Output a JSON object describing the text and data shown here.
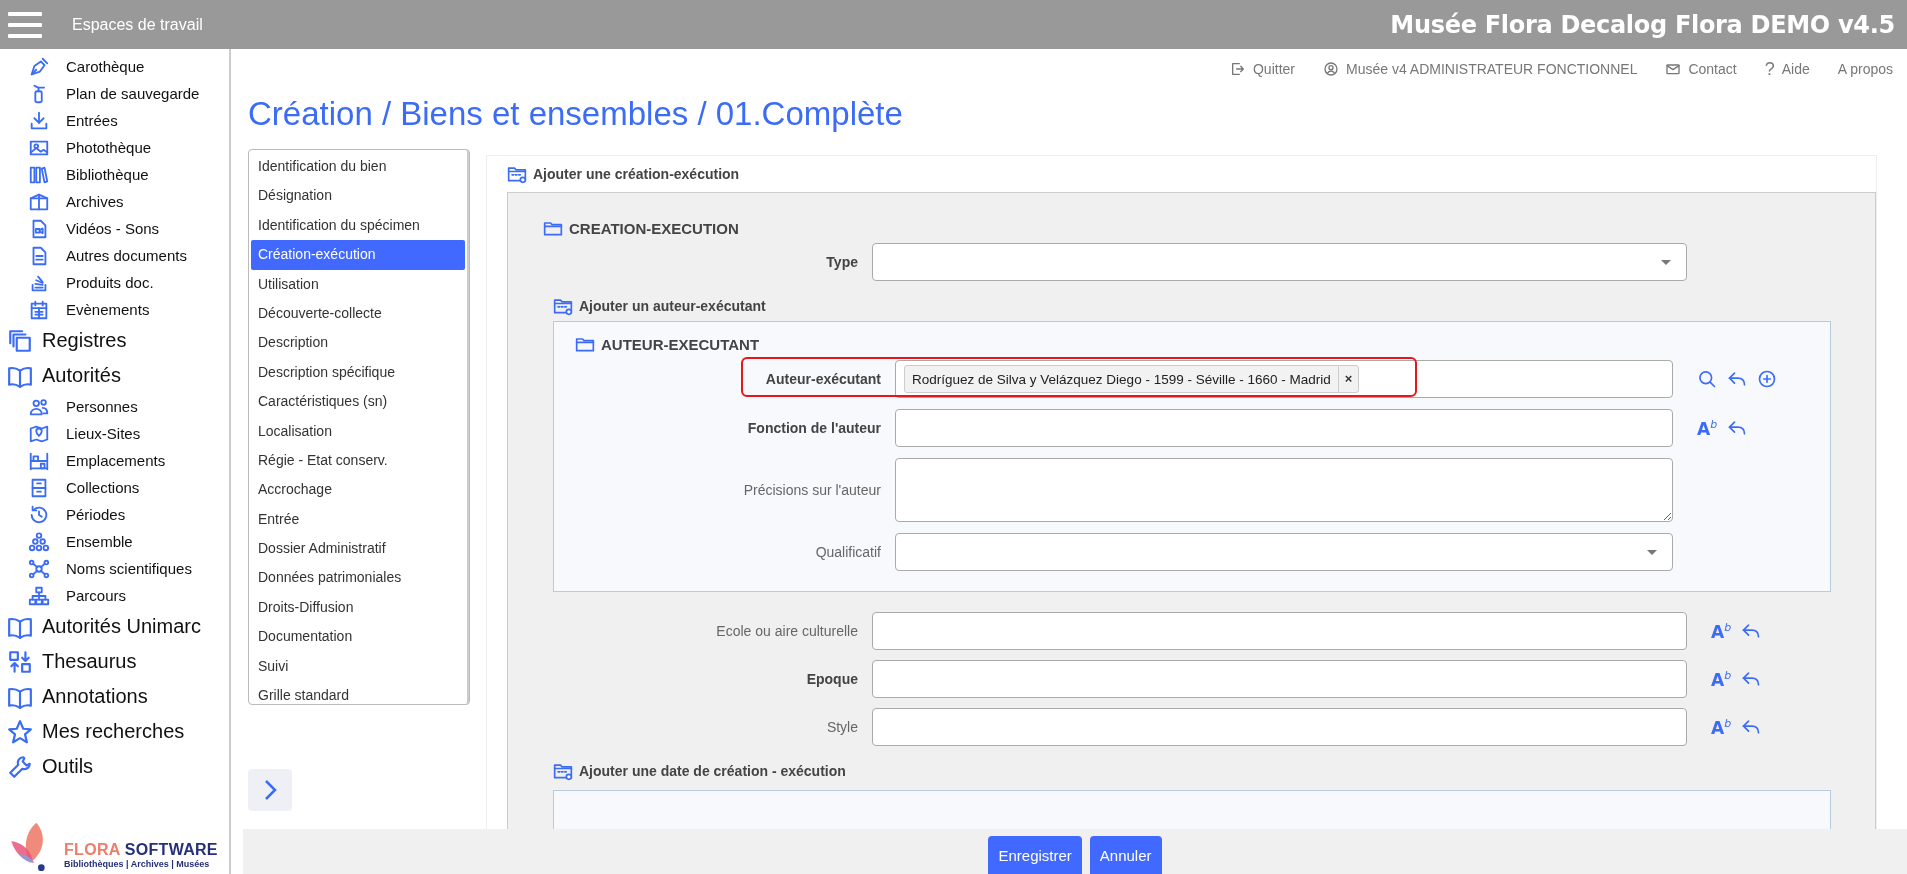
{
  "header": {
    "workspace_label": "Espaces de travail",
    "app_title": "Musée Flora Decalog Flora DEMO v4.5"
  },
  "sidebar": {
    "items": [
      {
        "label": "Carothèque",
        "kind": "sub"
      },
      {
        "label": "Plan de sauvegarde",
        "kind": "sub"
      },
      {
        "label": "Entrées",
        "kind": "sub"
      },
      {
        "label": "Photothèque",
        "kind": "sub"
      },
      {
        "label": "Bibliothèque",
        "kind": "sub"
      },
      {
        "label": "Archives",
        "kind": "sub"
      },
      {
        "label": "Vidéos - Sons",
        "kind": "sub"
      },
      {
        "label": "Autres documents",
        "kind": "sub"
      },
      {
        "label": "Produits doc.",
        "kind": "sub"
      },
      {
        "label": "Evènements",
        "kind": "sub"
      },
      {
        "label": "Registres",
        "kind": "main"
      },
      {
        "label": "Autorités",
        "kind": "main"
      },
      {
        "label": "Personnes",
        "kind": "sub"
      },
      {
        "label": "Lieux-Sites",
        "kind": "sub"
      },
      {
        "label": "Emplacements",
        "kind": "sub"
      },
      {
        "label": "Collections",
        "kind": "sub"
      },
      {
        "label": "Périodes",
        "kind": "sub"
      },
      {
        "label": "Ensemble",
        "kind": "sub"
      },
      {
        "label": "Noms scientifiques",
        "kind": "sub"
      },
      {
        "label": "Parcours",
        "kind": "sub"
      },
      {
        "label": "Autorités Unimarc",
        "kind": "main"
      },
      {
        "label": "Thesaurus",
        "kind": "main"
      },
      {
        "label": "Annotations",
        "kind": "main"
      },
      {
        "label": "Mes recherches",
        "kind": "main"
      },
      {
        "label": "Outils",
        "kind": "main"
      }
    ],
    "logo": {
      "brand_primary": "FLORA",
      "brand_secondary": "SOFTWARE",
      "tagline": "Bibliothèques | Archives | Musées"
    }
  },
  "top_links": [
    {
      "label": "Quitter",
      "kind": "exit"
    },
    {
      "label": "Musée v4 ADMINISTRATEUR FONCTIONNEL",
      "kind": "user"
    },
    {
      "label": "Contact",
      "kind": "mail"
    },
    {
      "label": "Aide",
      "kind": "glyph",
      "glyph": "?"
    },
    {
      "label": "A propos",
      "kind": "plain"
    }
  ],
  "page_title": "Création / Biens et ensembles / 01.Complète",
  "nav": {
    "items": [
      {
        "label": "Identification du bien",
        "selected": false
      },
      {
        "label": "Désignation",
        "selected": false
      },
      {
        "label": "Identification du spécimen",
        "selected": false
      },
      {
        "label": "Création-exécution",
        "selected": true
      },
      {
        "label": "Utilisation",
        "selected": false
      },
      {
        "label": "Découverte-collecte",
        "selected": false
      },
      {
        "label": "Description",
        "selected": false
      },
      {
        "label": "Description spécifique",
        "selected": false
      },
      {
        "label": "Caractéristiques (sn)",
        "selected": false
      },
      {
        "label": "Localisation",
        "selected": false
      },
      {
        "label": "Régie - Etat conserv.",
        "selected": false
      },
      {
        "label": "Accrochage",
        "selected": false
      },
      {
        "label": "Entrée",
        "selected": false
      },
      {
        "label": "Dossier Administratif",
        "selected": false
      },
      {
        "label": "Données patrimoniales",
        "selected": false
      },
      {
        "label": "Droits-Diffusion",
        "selected": false
      },
      {
        "label": "Documentation",
        "selected": false
      },
      {
        "label": "Suivi",
        "selected": false
      },
      {
        "label": "Grille standard",
        "selected": false
      }
    ]
  },
  "form": {
    "add_title": "Ajouter une création-exécution",
    "section": {
      "title": "CREATION-EXECUTION",
      "fields_top": [
        {
          "label": "Type",
          "kind": "select",
          "required": true
        }
      ],
      "sub_add_title": "Ajouter un auteur-exécutant",
      "subsection": {
        "title": "AUTEUR-EXECUTANT",
        "fields": [
          {
            "label": "Auteur-exécutant",
            "kind": "tags",
            "required": true,
            "highlighted": true,
            "tags": [
              {
                "text": "Rodríguez de Silva y Velázquez Diego - 1599 - Séville - 1660 - Madrid",
                "remove": "×"
              }
            ],
            "tools": [
              {
                "kind": "search"
              },
              {
                "kind": "undo"
              },
              {
                "kind": "add"
              }
            ]
          },
          {
            "label": "Fonction de l'auteur",
            "kind": "text",
            "required": true,
            "tools": [
              {
                "kind": "format",
                "text": "A$^{b}$"
              },
              {
                "kind": "undo"
              }
            ]
          },
          {
            "label": "Précisions sur l'auteur",
            "kind": "textarea",
            "required": false
          },
          {
            "label": "Qualificatif",
            "kind": "select",
            "required": false
          }
        ]
      },
      "fields_bottom": [
        {
          "label": "Ecole ou aire culturelle",
          "kind": "text",
          "required": false,
          "tools": [
            {
              "kind": "format",
              "text": "A$^{b}$"
            },
            {
              "kind": "undo"
            }
          ]
        },
        {
          "label": "Epoque",
          "kind": "text",
          "required": true,
          "tools": [
            {
              "kind": "format",
              "text": "A$^{b}$"
            },
            {
              "kind": "undo"
            }
          ]
        },
        {
          "label": "Style",
          "kind": "text",
          "required": false,
          "tools": [
            {
              "kind": "format",
              "text": "A$^{b}$"
            },
            {
              "kind": "undo"
            }
          ]
        }
      ],
      "date_add_title": "Ajouter une date de création - exécution"
    }
  },
  "buttons": [
    {
      "label": "Enregistrer"
    },
    {
      "label": "Annuler"
    }
  ]
}
